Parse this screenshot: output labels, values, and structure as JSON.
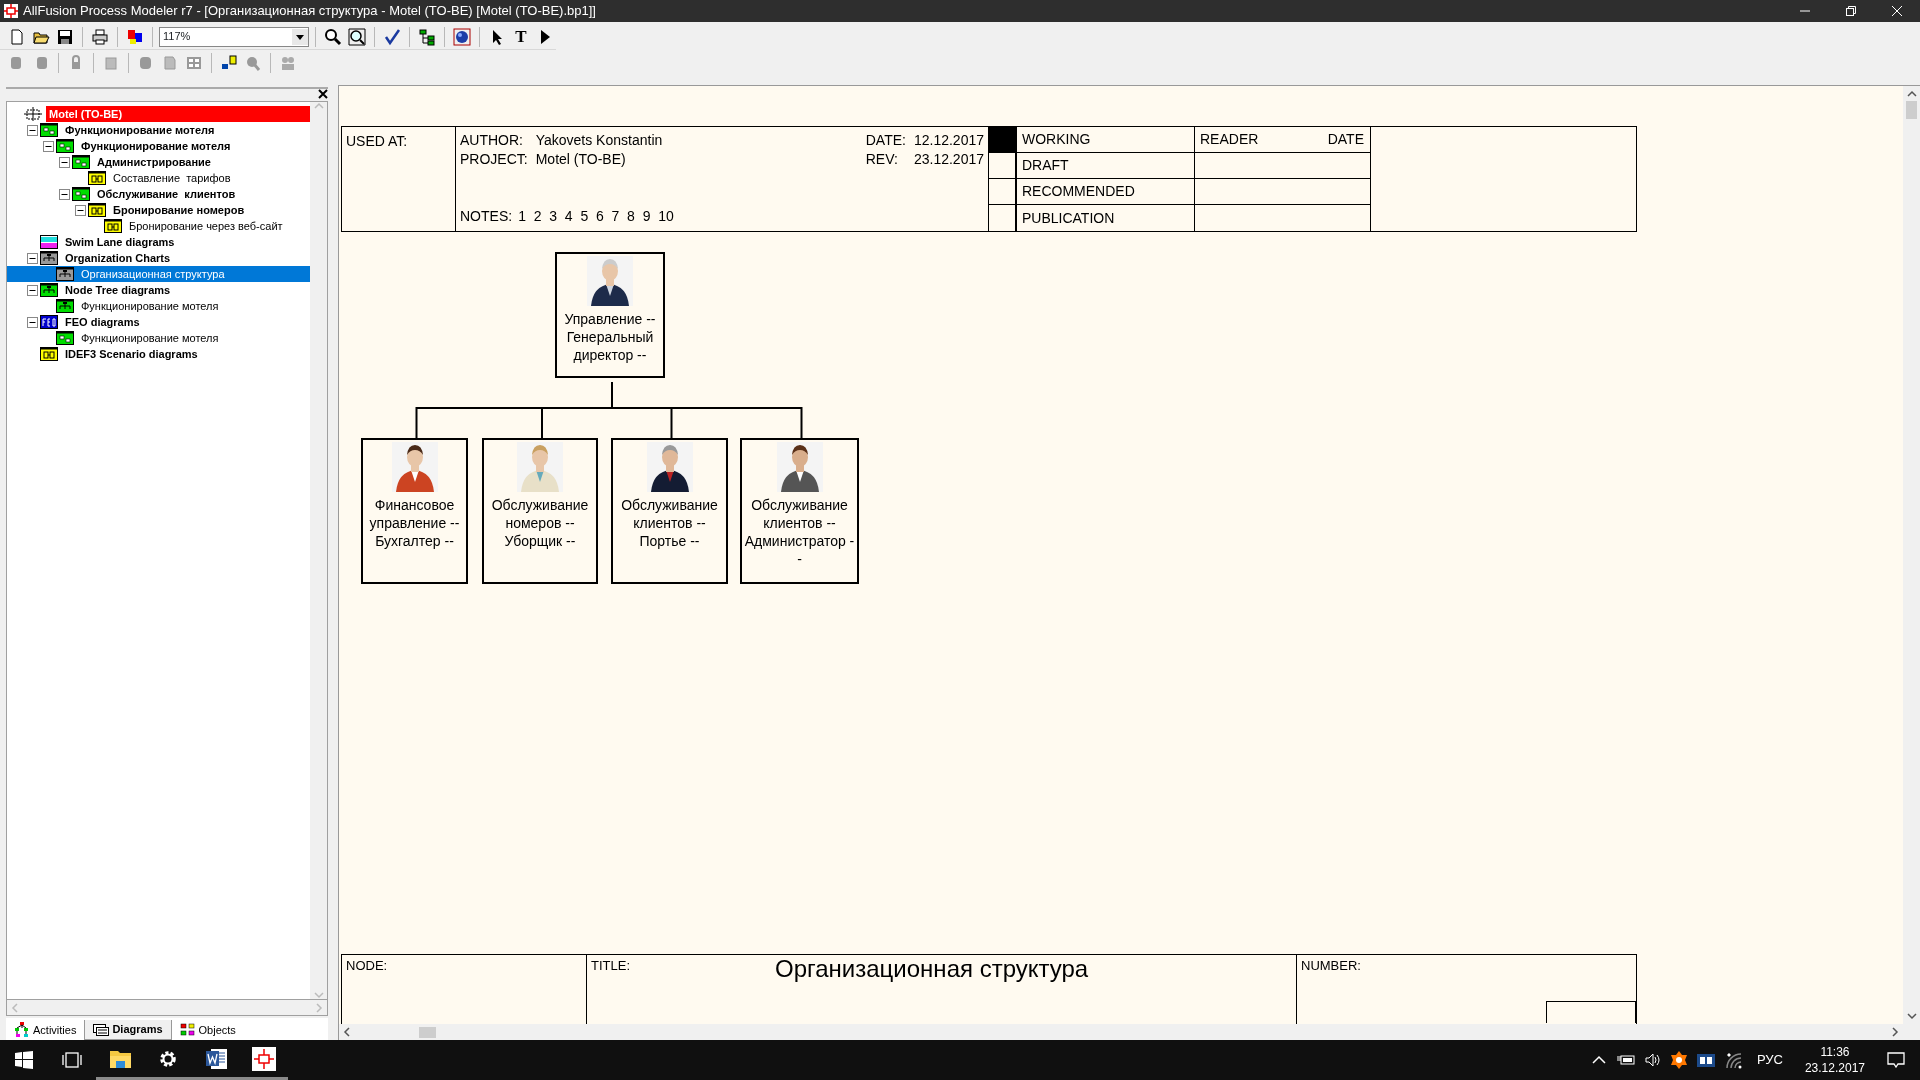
{
  "window": {
    "title": "AllFusion Process Modeler r7 - [Организационная структура - Motel (TO-BE)  [Motel (TO-BE).bp1]]"
  },
  "toolbar": {
    "zoom": "117%",
    "text_tool": "T"
  },
  "model_tree": {
    "items": [
      {
        "label": "Motel (TO-BE)",
        "kind": "model",
        "bold": true,
        "selected": false,
        "children": [
          {
            "label": "Функционирование мотеля",
            "kind": "idef0",
            "bold": true,
            "selected": false,
            "expanded": true,
            "children": [
              {
                "label": "Функционирование мотеля",
                "kind": "idef0",
                "bold": true,
                "selected": false,
                "expanded": true,
                "children": [
                  {
                    "label": "Администрирование",
                    "kind": "idef0",
                    "bold": true,
                    "selected": false,
                    "expanded": true,
                    "children": [
                      {
                        "label": "Составление  тарифов",
                        "kind": "idef3",
                        "bold": false,
                        "selected": false
                      }
                    ]
                  },
                  {
                    "label": "Обслуживание  клиентов",
                    "kind": "idef0",
                    "bold": true,
                    "selected": false,
                    "expanded": true,
                    "children": [
                      {
                        "label": "Бронирование номеров",
                        "kind": "idef3",
                        "bold": true,
                        "selected": false,
                        "expanded": true,
                        "children": [
                          {
                            "label": "Бронирование через веб-сайт",
                            "kind": "idef3",
                            "bold": false,
                            "selected": false
                          }
                        ]
                      }
                    ]
                  }
                ]
              }
            ]
          },
          {
            "label": "Swim Lane diagrams",
            "kind": "swimlane",
            "bold": true,
            "selected": false
          },
          {
            "label": "Organization Charts",
            "kind": "orgchart",
            "bold": true,
            "selected": false,
            "expanded": true,
            "children": [
              {
                "label": "Организационная структура",
                "kind": "orgchart",
                "bold": false,
                "selected": true
              }
            ]
          },
          {
            "label": "Node Tree diagrams",
            "kind": "nodetree",
            "bold": true,
            "selected": false,
            "expanded": true,
            "children": [
              {
                "label": "Функционирование мотеля",
                "kind": "nodetree",
                "bold": false,
                "selected": false
              }
            ]
          },
          {
            "label": "FEO diagrams",
            "kind": "feo",
            "bold": true,
            "selected": false,
            "expanded": true,
            "children": [
              {
                "label": "Функционирование мотеля",
                "kind": "idef0",
                "bold": false,
                "selected": false
              }
            ]
          },
          {
            "label": "IDEF3 Scenario diagrams",
            "kind": "idef3",
            "bold": true,
            "selected": false
          }
        ]
      }
    ]
  },
  "panel_tabs": [
    {
      "label": "Activities",
      "kind": "activities",
      "selected": false
    },
    {
      "label": "Diagrams",
      "kind": "diagrams",
      "selected": true
    },
    {
      "label": "Objects",
      "kind": "objects",
      "selected": false
    }
  ],
  "diagram": {
    "header": {
      "used_at": "USED AT:",
      "author_label": "AUTHOR:",
      "author": "Yakovets Konstantin",
      "project_label": "PROJECT:",
      "project": "Motel (TO-BE)",
      "date_label": "DATE:",
      "date": "12.12.2017",
      "rev_label": "REV:",
      "rev": "23.12.2017",
      "notes_label": "NOTES:",
      "notes": "1  2  3  4  5  6  7  8  9  10",
      "statuses": [
        {
          "label": "WORKING",
          "checked": true
        },
        {
          "label": "DRAFT",
          "checked": false
        },
        {
          "label": "RECOMMENDED",
          "checked": false
        },
        {
          "label": "PUBLICATION",
          "checked": false
        }
      ],
      "reader_label": "READER",
      "reader_date_label": "DATE"
    },
    "org_chart": {
      "root": {
        "label": "Управление -- Генеральный директор --",
        "children": [
          {
            "label": "Финансовое управление -- Бухгалтер --"
          },
          {
            "label": "Обслуживание номеров -- Уборщик --"
          },
          {
            "label": "Обслуживание клиентов -- Портье --"
          },
          {
            "label": "Обслуживание клиентов -- Администратор --"
          }
        ]
      }
    },
    "footer": {
      "node_label": "NODE:",
      "title_label": "TITLE:",
      "title": "Организационная структура",
      "number_label": "NUMBER:"
    }
  },
  "taskbar": {
    "language": "РУС",
    "time": "11:36",
    "date": "23.12.2017"
  }
}
